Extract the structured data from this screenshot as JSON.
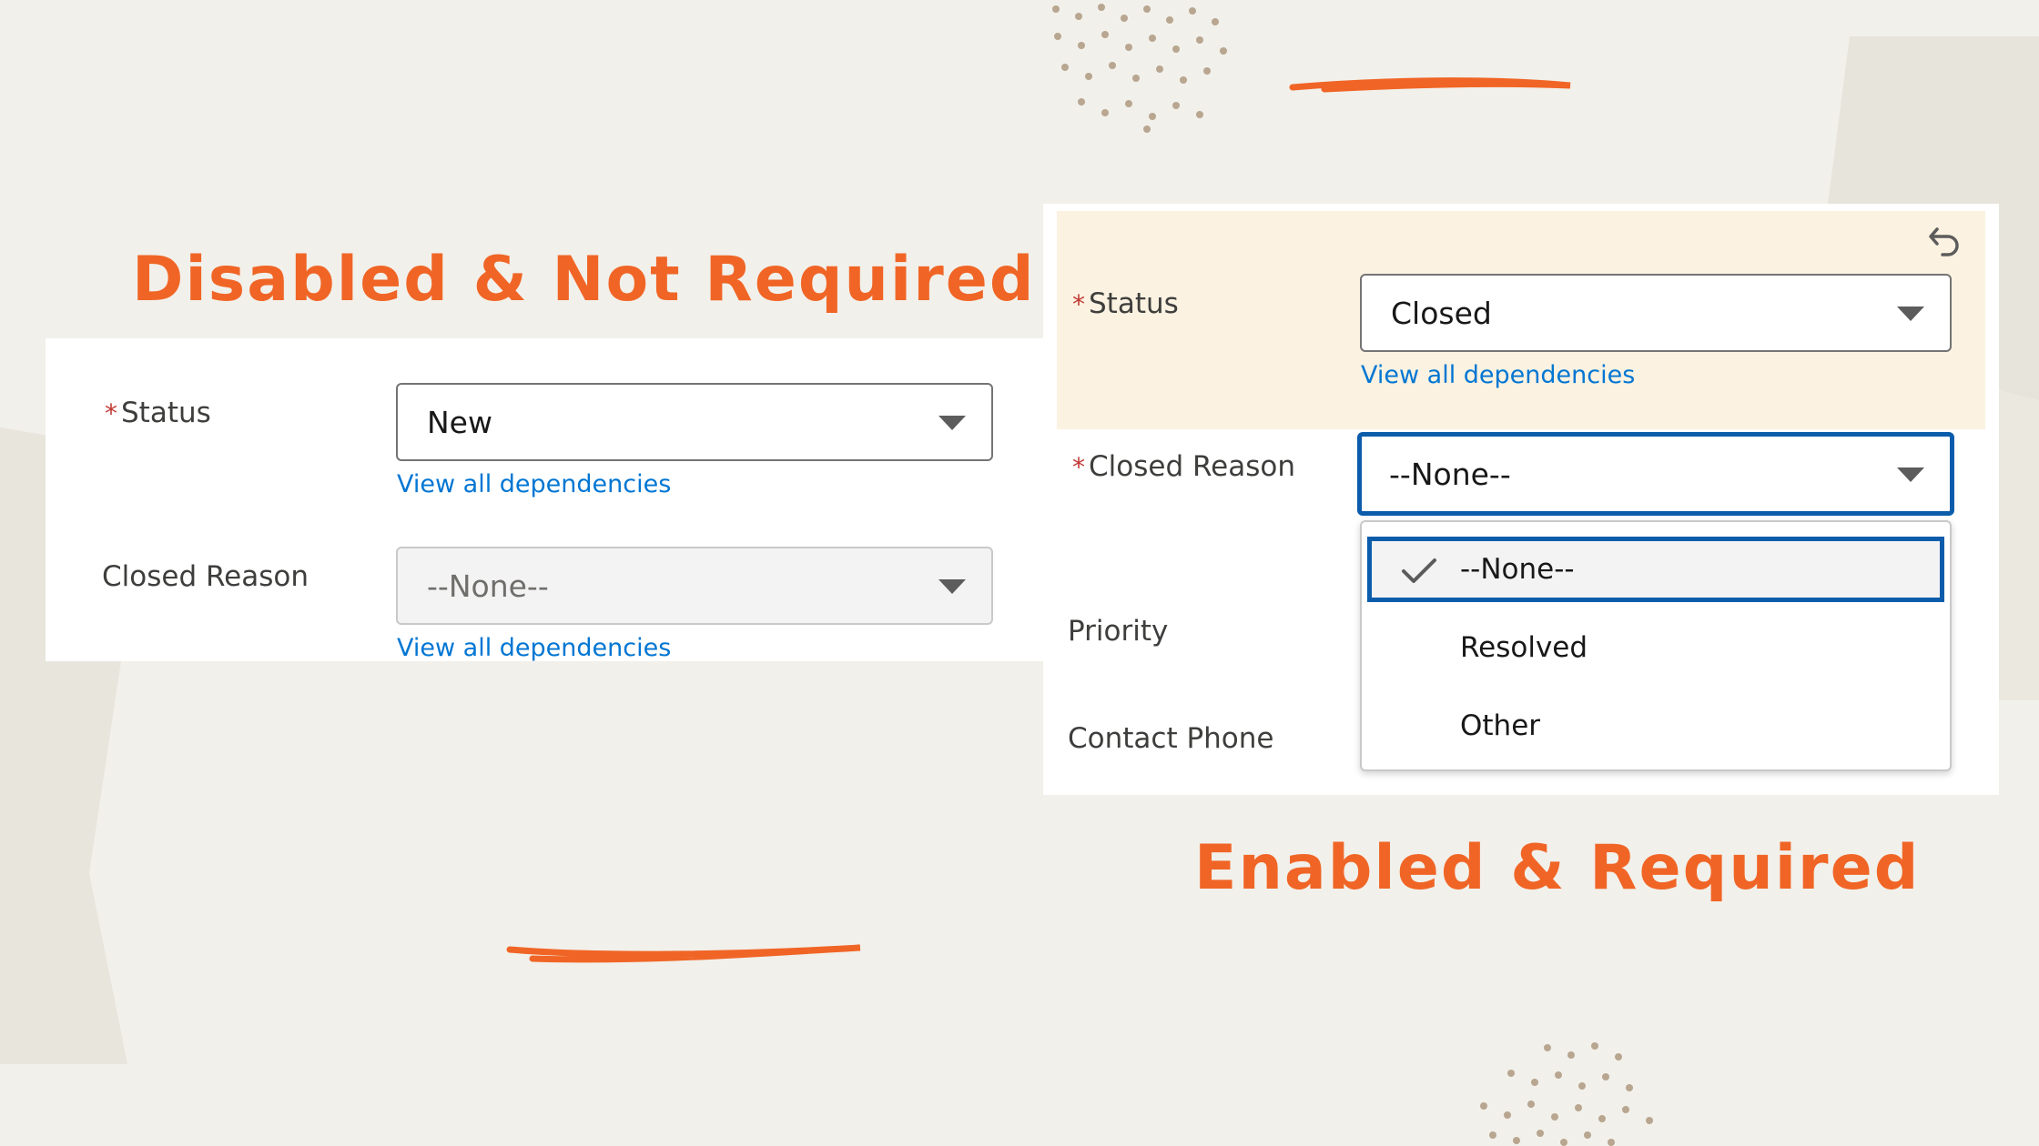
{
  "headings": {
    "left": "Disabled & Not Required",
    "right": "Enabled & Required"
  },
  "left_panel": {
    "status": {
      "label": "Status",
      "required_mark": "*",
      "value": "New",
      "link": "View all dependencies"
    },
    "closed_reason": {
      "label": "Closed Reason",
      "value": "--None--",
      "link": "View all dependencies",
      "state": "disabled"
    }
  },
  "right_panel": {
    "status": {
      "label": "Status",
      "required_mark": "*",
      "value": "Closed",
      "link": "View all dependencies"
    },
    "closed_reason": {
      "label": "Closed Reason",
      "required_mark": "*",
      "value": "--None--",
      "state": "focused"
    },
    "priority": {
      "label": "Priority"
    },
    "contact_phone": {
      "label": "Contact Phone"
    },
    "dropdown_options": [
      {
        "label": "--None--",
        "selected": true
      },
      {
        "label": "Resolved",
        "selected": false
      },
      {
        "label": "Other",
        "selected": false
      }
    ]
  },
  "icons": [
    "undo-icon",
    "check-icon",
    "chevron-down-icon"
  ],
  "colors": {
    "accent": "#f06526",
    "link": "#0176d3",
    "focus": "#0b5cab",
    "required": "#c23934",
    "highlight": "#fbf2e1"
  }
}
